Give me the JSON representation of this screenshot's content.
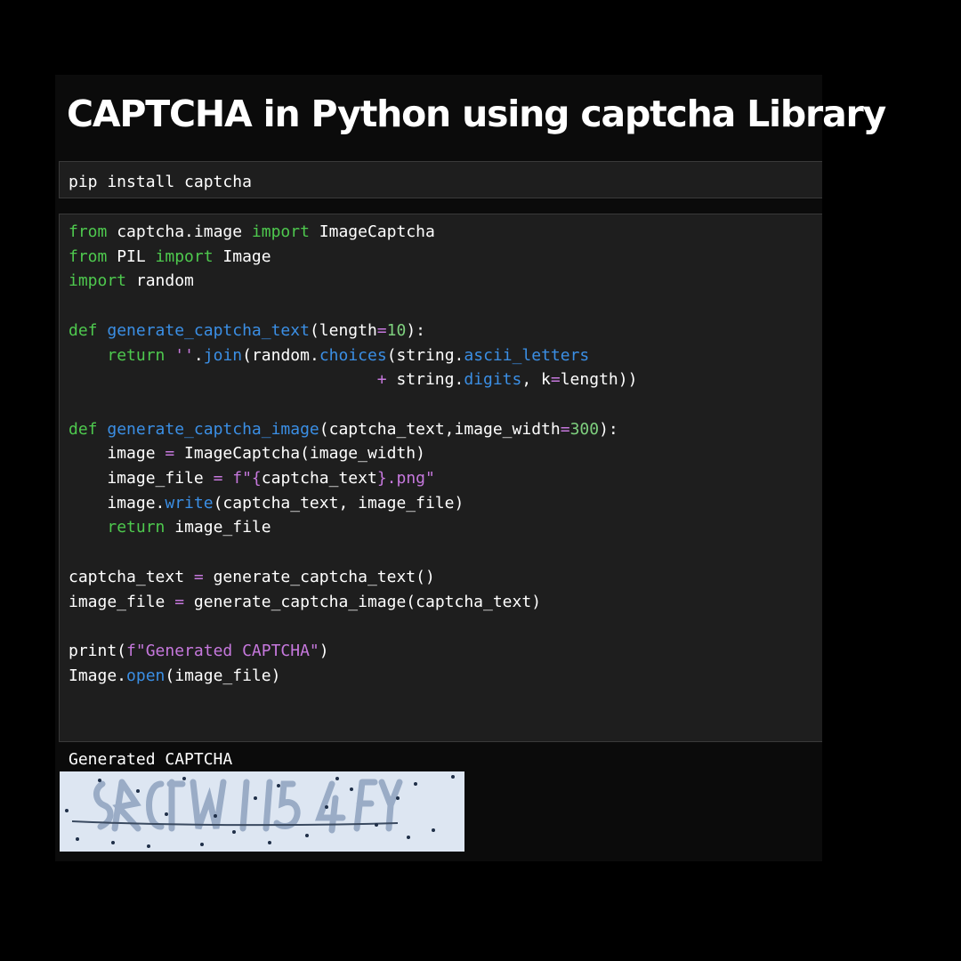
{
  "title": "CAPTCHA in Python using captcha Library",
  "install_cell": {
    "code": "pip install captcha"
  },
  "code_cell": {
    "lines": [
      [
        {
          "t": "from",
          "c": "kw"
        },
        {
          "t": " captcha.image "
        },
        {
          "t": "import",
          "c": "kw"
        },
        {
          "t": " ImageCaptcha"
        }
      ],
      [
        {
          "t": "from",
          "c": "kw"
        },
        {
          "t": " PIL "
        },
        {
          "t": "import",
          "c": "kw"
        },
        {
          "t": " Image"
        }
      ],
      [
        {
          "t": "import",
          "c": "kw"
        },
        {
          "t": " random"
        }
      ],
      [],
      [
        {
          "t": "def",
          "c": "kw"
        },
        {
          "t": " "
        },
        {
          "t": "generate_captcha_text",
          "c": "fn"
        },
        {
          "t": "(length"
        },
        {
          "t": "=",
          "c": "op"
        },
        {
          "t": "10",
          "c": "num"
        },
        {
          "t": "):"
        }
      ],
      [
        {
          "t": "    "
        },
        {
          "t": "return",
          "c": "kw"
        },
        {
          "t": " "
        },
        {
          "t": "''",
          "c": "str"
        },
        {
          "t": "."
        },
        {
          "t": "join",
          "c": "fn"
        },
        {
          "t": "(random."
        },
        {
          "t": "choices",
          "c": "fn"
        },
        {
          "t": "(string."
        },
        {
          "t": "ascii_letters",
          "c": "fn"
        }
      ],
      [
        {
          "t": "                                "
        },
        {
          "t": "+",
          "c": "op"
        },
        {
          "t": " string."
        },
        {
          "t": "digits",
          "c": "fn"
        },
        {
          "t": ", k"
        },
        {
          "t": "=",
          "c": "op"
        },
        {
          "t": "length))"
        }
      ],
      [],
      [
        {
          "t": "def",
          "c": "kw"
        },
        {
          "t": " "
        },
        {
          "t": "generate_captcha_image",
          "c": "fn"
        },
        {
          "t": "(captcha_text,image_width"
        },
        {
          "t": "=",
          "c": "op"
        },
        {
          "t": "300",
          "c": "num"
        },
        {
          "t": "):"
        }
      ],
      [
        {
          "t": "    image "
        },
        {
          "t": "=",
          "c": "op"
        },
        {
          "t": " ImageCaptcha(image_width)"
        }
      ],
      [
        {
          "t": "    image_file "
        },
        {
          "t": "=",
          "c": "op"
        },
        {
          "t": " "
        },
        {
          "t": "f\"{",
          "c": "str"
        },
        {
          "t": "captcha_text"
        },
        {
          "t": "}.png\"",
          "c": "str"
        }
      ],
      [
        {
          "t": "    image."
        },
        {
          "t": "write",
          "c": "fn"
        },
        {
          "t": "(captcha_text, image_file)"
        }
      ],
      [
        {
          "t": "    "
        },
        {
          "t": "return",
          "c": "kw"
        },
        {
          "t": " image_file"
        }
      ],
      [],
      [
        {
          "t": "captcha_text "
        },
        {
          "t": "=",
          "c": "op"
        },
        {
          "t": " generate_captcha_text()"
        }
      ],
      [
        {
          "t": "image_file "
        },
        {
          "t": "=",
          "c": "op"
        },
        {
          "t": " generate_captcha_image(captcha_text)"
        }
      ],
      [],
      [
        {
          "t": "print(",
          "c": ""
        },
        {
          "t": "f\"Generated CAPTCHA\"",
          "c": "str"
        },
        {
          "t": ")"
        }
      ],
      [
        {
          "t": "Image."
        },
        {
          "t": "open",
          "c": "fn"
        },
        {
          "t": "(image_file)"
        }
      ]
    ]
  },
  "output": {
    "text": "Generated CAPTCHA",
    "image_alt": "generated captcha image"
  },
  "colors": {
    "background": "#000000",
    "cell_background": "#1e1e1e",
    "keyword": "#4ec94e",
    "function": "#3b8fe5",
    "number": "#7ed07e",
    "string": "#c678dd",
    "captcha_background": "#dde6f2"
  }
}
